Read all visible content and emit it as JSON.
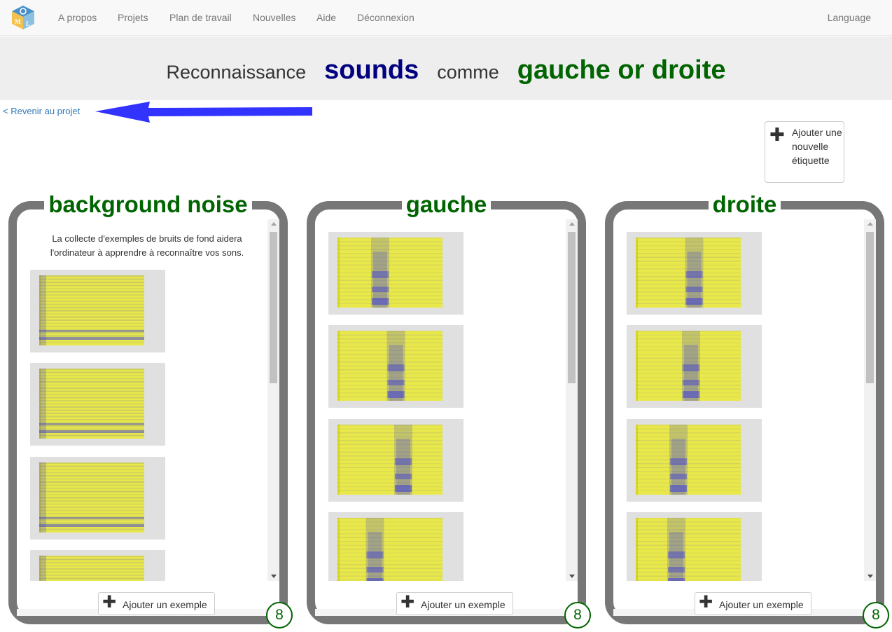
{
  "nav": {
    "items": [
      "A propos",
      "Projets",
      "Plan de travail",
      "Nouvelles",
      "Aide",
      "Déconnexion"
    ],
    "language": "Language",
    "logo_letters": [
      "M",
      "L"
    ]
  },
  "header": {
    "prefix": "Reconnaissance",
    "type": "sounds",
    "middle": "comme",
    "labels": "gauche or droite"
  },
  "back_link": "< Revenir au projet",
  "add_label": "Ajouter une nouvelle étiquette",
  "panels": [
    {
      "title": "background noise",
      "intro": "La collecte d'exemples de bruits de fond aidera l'ordinateur à apprendre à reconnaître vos sons.",
      "add_example": "Ajouter un exemple",
      "count": "8"
    },
    {
      "title": "gauche",
      "add_example": "Ajouter un exemple",
      "count": "8"
    },
    {
      "title": "droite",
      "add_example": "Ajouter un exemple",
      "count": "8"
    }
  ],
  "colors": {
    "title_green": "#006400",
    "sounds_blue": "#000080",
    "panel_border": "#777777",
    "arrow_blue": "#3333ff",
    "spec_yellow": "#e8e84a",
    "spec_blue": "#3f3fd8"
  }
}
